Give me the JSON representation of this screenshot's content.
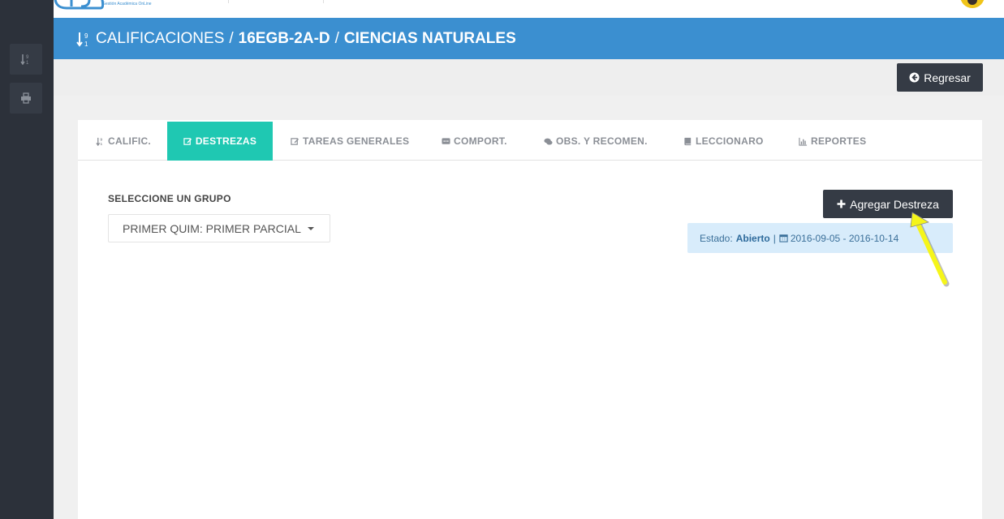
{
  "branding": {
    "logo_subtitle": "Gestión Académica OnLine"
  },
  "header": {
    "section": "CALIFICACIONES",
    "separator": "/",
    "course": "16EGB-2A-D",
    "subject": "CIENCIAS NATURALES"
  },
  "actions": {
    "back_label": "Regresar",
    "back_icon": "arrow-circle-left-icon"
  },
  "sidebar": {
    "items": [
      {
        "icon": "sort-numeric-icon"
      },
      {
        "icon": "print-icon"
      }
    ]
  },
  "tabs": [
    {
      "label": "CALIFIC.",
      "icon": "sort-numeric-icon",
      "active": false
    },
    {
      "label": "DESTREZAS",
      "icon": "edit-icon",
      "active": true
    },
    {
      "label": "TAREAS GENERALES",
      "icon": "edit-icon",
      "active": false
    },
    {
      "label": "COMPORT.",
      "icon": "comment-icon",
      "active": false
    },
    {
      "label": "OBS. Y RECOMEN.",
      "icon": "comments-icon",
      "active": false
    },
    {
      "label": "LECCIONARO",
      "icon": "book-icon",
      "active": false
    },
    {
      "label": "REPORTES",
      "icon": "bar-chart-icon",
      "active": false
    }
  ],
  "group": {
    "label": "SELECCIONE UN GRUPO",
    "selected": "PRIMER QUIM: PRIMER PARCIAL"
  },
  "add_button": {
    "label": "Agregar Destreza",
    "icon": "plus-icon"
  },
  "status": {
    "prefix": "Estado:",
    "value": "Abierto",
    "separator": "|",
    "date_range": "2016-09-05 - 2016-10-14"
  },
  "colors": {
    "header_blue": "#3b8fd0",
    "active_tab": "#1fc8b2",
    "dark_button": "#353b45",
    "sidebar": "#2c313a",
    "status_bg": "#d8ecfb",
    "pointer_arrow": "#f5f51a"
  }
}
